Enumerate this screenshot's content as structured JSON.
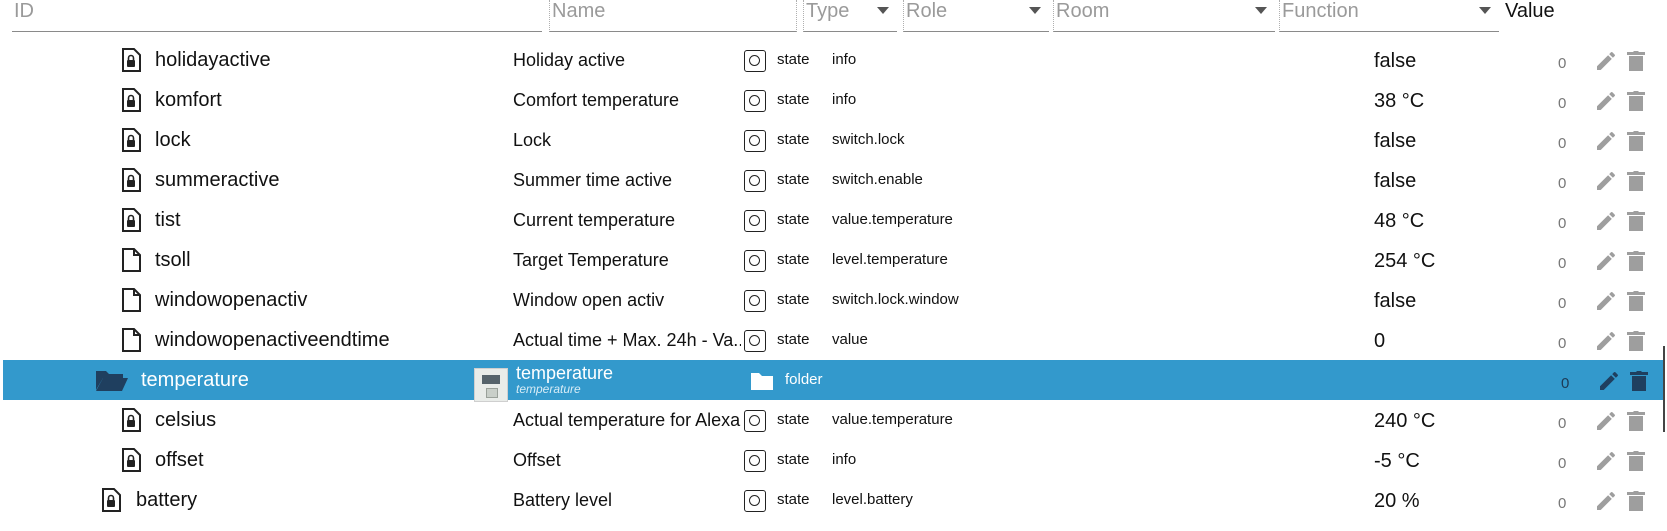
{
  "header": {
    "id_placeholder": "ID",
    "name_placeholder": "Name",
    "type_placeholder": "Type",
    "role_placeholder": "Role",
    "room_placeholder": "Room",
    "function_placeholder": "Function",
    "value_label": "Value"
  },
  "rows": [
    {
      "id": "holidayactive",
      "name": "Holiday active",
      "type": "state",
      "role": "info",
      "value": "false",
      "ack": "0",
      "icon": "locked-file-icon"
    },
    {
      "id": "komfort",
      "name": "Comfort temperature",
      "type": "state",
      "role": "info",
      "value": "38 °C",
      "ack": "0",
      "icon": "locked-file-icon"
    },
    {
      "id": "lock",
      "name": "Lock",
      "type": "state",
      "role": "switch.lock",
      "value": "false",
      "ack": "0",
      "icon": "locked-file-icon"
    },
    {
      "id": "summeractive",
      "name": "Summer time active",
      "type": "state",
      "role": "switch.enable",
      "value": "false",
      "ack": "0",
      "icon": "locked-file-icon"
    },
    {
      "id": "tist",
      "name": "Current temperature",
      "type": "state",
      "role": "value.temperature",
      "value": "48 °C",
      "ack": "0",
      "icon": "locked-file-icon"
    },
    {
      "id": "tsoll",
      "name": "Target Temperature",
      "type": "state",
      "role": "level.temperature",
      "value": "254 °C",
      "ack": "0",
      "icon": "file-icon"
    },
    {
      "id": "windowopenactiv",
      "name": "Window open activ",
      "type": "state",
      "role": "switch.lock.window",
      "value": "false",
      "ack": "0",
      "icon": "file-icon"
    },
    {
      "id": "windowopenactiveendtime",
      "name": "Actual time + Max. 24h - Va...",
      "type": "state",
      "role": "value",
      "value": "0",
      "ack": "0",
      "icon": "file-icon"
    },
    {
      "id": "temperature",
      "name": "temperature",
      "name_sub": "temperature",
      "type": "folder",
      "role": "",
      "value": "",
      "ack": "0",
      "icon": "open-folder-icon",
      "selected": true
    },
    {
      "id": "celsius",
      "name": "Actual temperature for Alexa",
      "type": "state",
      "role": "value.temperature",
      "value": "240 °C",
      "ack": "0",
      "icon": "locked-file-icon"
    },
    {
      "id": "offset",
      "name": "Offset",
      "type": "state",
      "role": "info",
      "value": "-5 °C",
      "ack": "0",
      "icon": "locked-file-icon"
    },
    {
      "id": "battery",
      "name": "Battery level",
      "type": "state",
      "role": "level.battery",
      "value": "20 %",
      "ack": "0",
      "icon": "locked-file-icon"
    }
  ],
  "colors": {
    "selected_row": "#3399cc",
    "text": "#111111",
    "action_icons": "#9e9e9e"
  }
}
